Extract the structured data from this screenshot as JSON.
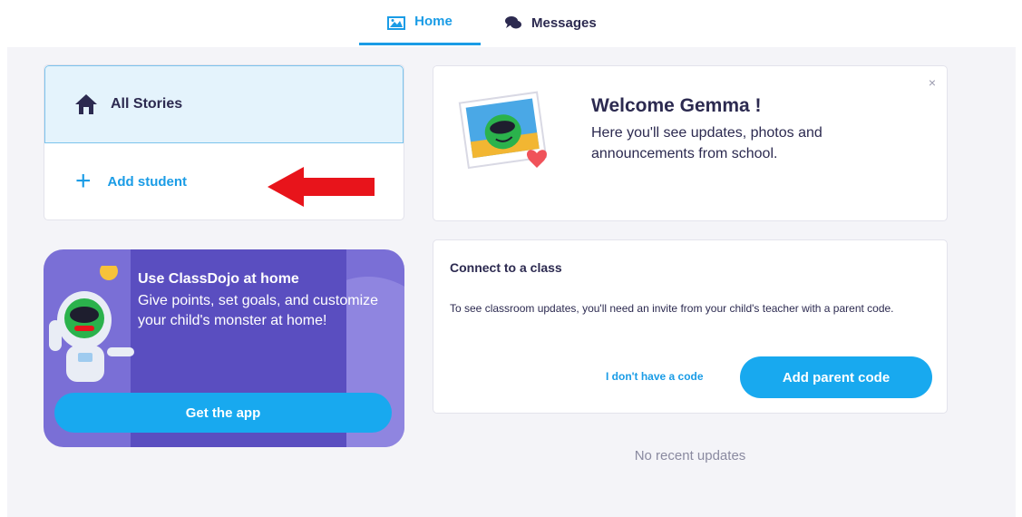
{
  "nav": {
    "tabs": [
      {
        "label": "Home",
        "icon": "home-icon",
        "active": true
      },
      {
        "label": "Messages",
        "icon": "chat-bubbles-icon",
        "active": false
      }
    ]
  },
  "stories": {
    "all_stories_label": "All Stories",
    "add_student_label": "Add student",
    "add_student_symbol": "+"
  },
  "promo": {
    "title": "Use ClassDojo at home",
    "body": "Give points, set goals, and customize your child's monster at home!",
    "button_label": "Get the app"
  },
  "welcome": {
    "title": "Welcome Gemma !",
    "body": "Here you'll see updates, photos and announcements from school.",
    "close_symbol": "×"
  },
  "connect": {
    "title": "Connect to a class",
    "body": "To see classroom updates, you'll need an invite from your child's teacher with a parent code.",
    "no_code_label": "I don't have a code",
    "add_code_label": "Add parent code"
  },
  "feed": {
    "empty_label": "No recent updates"
  },
  "colors": {
    "accent": "#1a9ce6",
    "button": "#18a9ef",
    "promo_bg": "#7a6fd6",
    "arrow": "#e8141b"
  }
}
